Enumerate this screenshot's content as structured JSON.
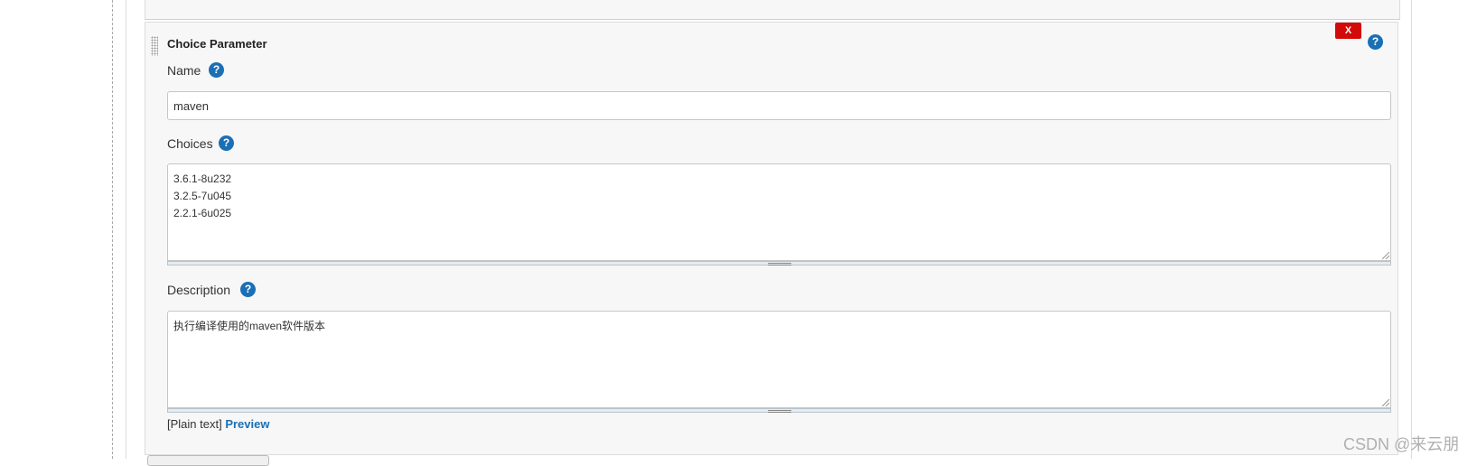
{
  "parameter": {
    "title": "Choice Parameter",
    "delete_label": "X",
    "help_glyph": "?",
    "name": {
      "label": "Name",
      "value": "maven"
    },
    "choices": {
      "label": "Choices",
      "value": "3.6.1-8u232\n3.2.5-7u045\n2.2.1-6u025"
    },
    "description": {
      "label": "Description",
      "value": "执行编译使用的maven软件版本",
      "plain_text": "[Plain text]",
      "preview": "Preview"
    }
  },
  "watermark": "CSDN @来云朋",
  "colors": {
    "delete": "#d20a0a",
    "help": "#1a6fb5",
    "link": "#1a6fb5",
    "panel": "#f7f7f7"
  },
  "icons": {
    "help": "help-icon",
    "drag": "drag-handle-icon"
  }
}
